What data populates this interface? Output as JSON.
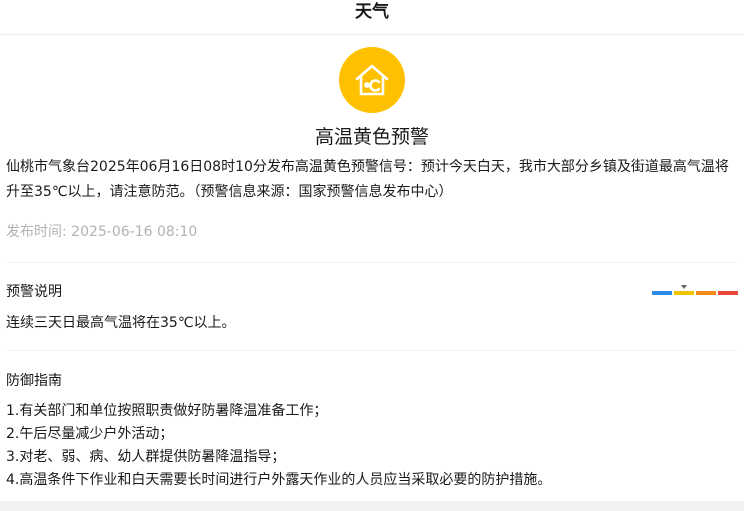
{
  "header": {
    "title": "天气"
  },
  "alert": {
    "icon": "house-heat-icon",
    "icon_color": "#ffc000",
    "title": "高温黄色预警",
    "body": "仙桃市气象台2025年06月16日08时10分发布高温黄色预警信号：预计今天白天，我市大部分乡镇及街道最高气温将升至35℃以上，请注意防范。（预警信息来源：国家预警信息发布中心）",
    "publish_label": "发布时间: ",
    "publish_time": "2025-06-16 08:10"
  },
  "explanation": {
    "heading": "预警说明",
    "text": "连续三天日最高气温将在35℃以上。",
    "levels": [
      {
        "color": "#2b8ae6"
      },
      {
        "color": "#f2c200"
      },
      {
        "color": "#f28a1c"
      },
      {
        "color": "#e8483c"
      }
    ],
    "current_level_index": 1
  },
  "guide": {
    "heading": "防御指南",
    "items": [
      "1.有关部门和单位按照职责做好防暑降温准备工作；",
      "2.午后尽量减少户外活动；",
      "3.对老、弱、病、幼人群提供防暑降温指导；",
      "4.高温条件下作业和白天需要长时间进行户外露天作业的人员应当采取必要的防护措施。"
    ]
  }
}
